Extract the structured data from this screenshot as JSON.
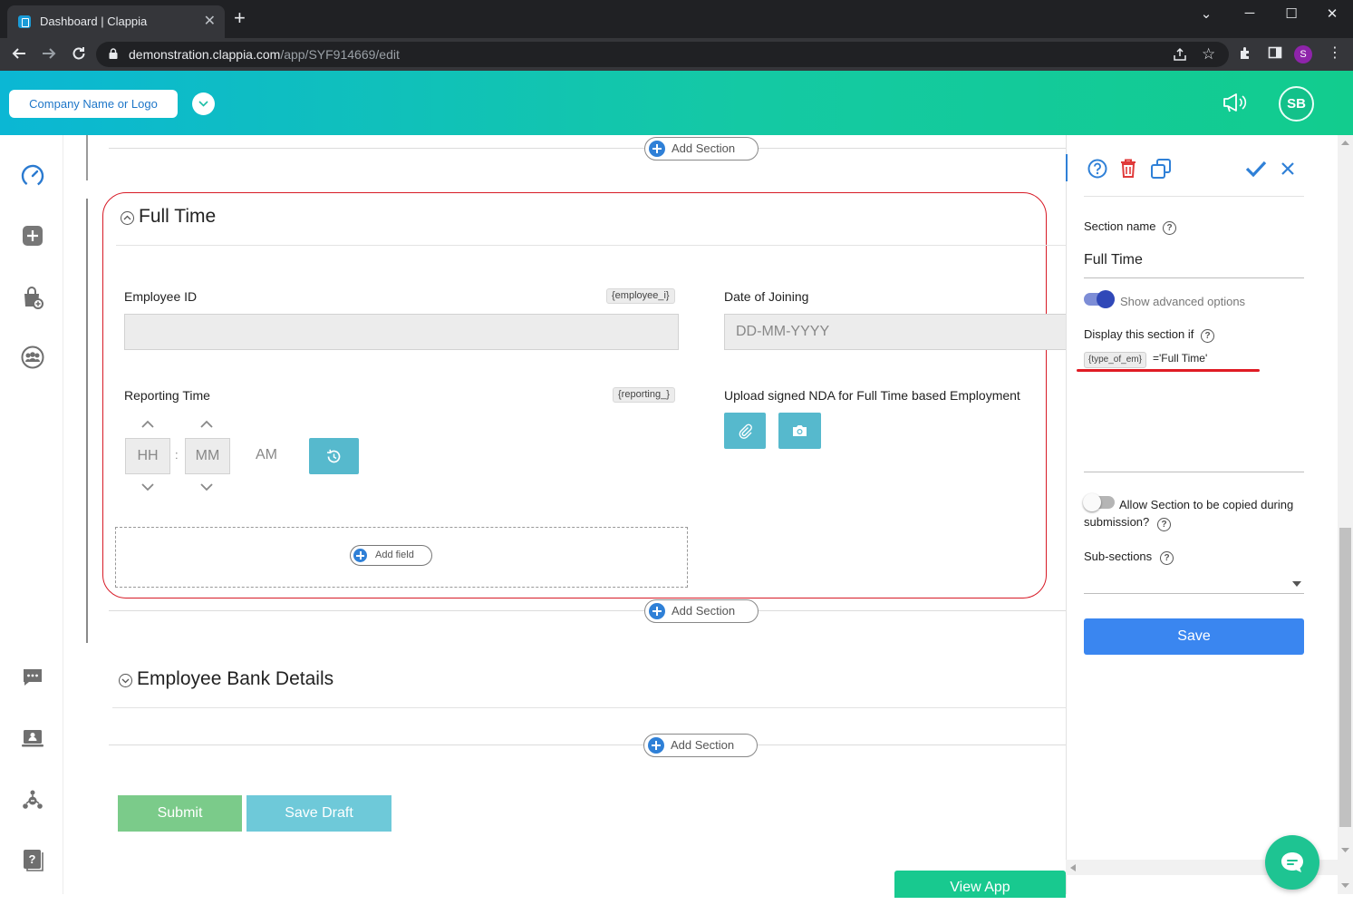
{
  "browser": {
    "tab_title": "Dashboard | Clappia",
    "url_host": "demonstration.clappia.com",
    "url_path": "/app/SYF914669/edit",
    "profile_initial": "S"
  },
  "header": {
    "company_label": "Company Name or Logo",
    "avatar_initials": "SB"
  },
  "sidebar": {
    "items": [
      "dashboard-icon",
      "add-app-icon",
      "marketplace-icon",
      "team-icon",
      "chat-icon",
      "workplace-icon",
      "workflow-icon",
      "help-book-icon"
    ]
  },
  "canvas": {
    "add_section_label": "Add Section",
    "sections": [
      {
        "title": "Full Time",
        "fields": {
          "employee_id": {
            "label": "Employee ID",
            "tag": "{employee_i}",
            "value": ""
          },
          "date_of_joining": {
            "label": "Date of Joining",
            "placeholder": "DD-MM-YYYY"
          },
          "reporting_time": {
            "label": "Reporting Time",
            "tag": "{reporting_}",
            "hh": "HH",
            "mm": "MM",
            "ampm": "AM",
            "separator": ":"
          },
          "upload_nda": {
            "label": "Upload signed NDA for Full Time based Employment"
          }
        },
        "add_field_label": "Add field"
      },
      {
        "title": "Employee Bank Details"
      }
    ],
    "submit_label": "Submit",
    "save_draft_label": "Save Draft",
    "view_app_label": "View App"
  },
  "panel": {
    "section_name_label": "Section name",
    "section_name_value": "Full Time",
    "advanced_toggle_label": "Show advanced options",
    "advanced_on": true,
    "display_if_label": "Display this section if",
    "condition_tag": "{type_of_em}",
    "condition_value": "='Full Time'",
    "allow_copy_label_1": "Allow Section to be copied during",
    "allow_copy_label_2": "submission?",
    "allow_copy_on": false,
    "subsections_label": "Sub-sections",
    "save_label": "Save"
  },
  "colors": {
    "brand_gradient_start": "#0bb7d4",
    "brand_gradient_end": "#12cc8e",
    "primary_blue": "#3a86f0",
    "highlight_red": "#d71a26",
    "submit_green": "#7bcb8a",
    "draft_teal": "#6ec9d9"
  }
}
